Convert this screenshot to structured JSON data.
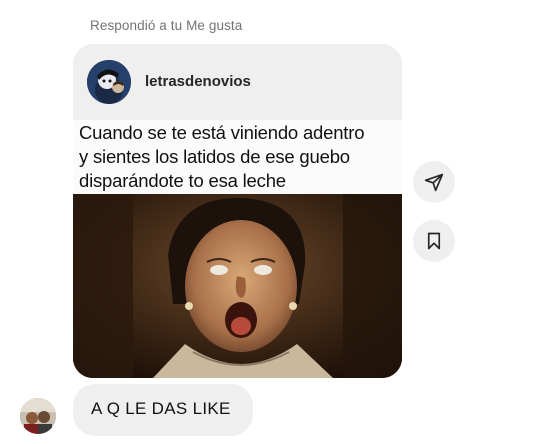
{
  "reply_note": "Respondió a tu Me gusta",
  "post": {
    "username": "letrasdenovios",
    "caption_lines": [
      "Cuando se te está viniendo adentro",
      "y sientes los latidos de ese guebo",
      "disparándote to esa leche"
    ]
  },
  "actions": {
    "share_icon": "paper-plane-icon",
    "save_icon": "bookmark-icon"
  },
  "message": {
    "text": "A Q LE DAS LIKE"
  },
  "colors": {
    "bubble": "#efefef",
    "muted_text": "#737373",
    "text": "#262626"
  }
}
